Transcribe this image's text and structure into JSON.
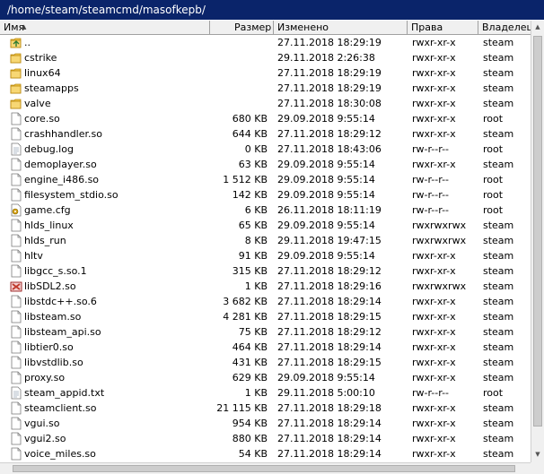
{
  "path": "/home/steam/steamcmd/masofkepb/",
  "columns": {
    "name": "Имя",
    "size": "Размер",
    "modified": "Изменено",
    "permissions": "Права",
    "owner": "Владелец"
  },
  "files": [
    {
      "name": "..",
      "size": "",
      "modified": "27.11.2018 18:29:19",
      "permissions": "rwxr-xr-x",
      "owner": "steam",
      "icon": "parent-folder-icon"
    },
    {
      "name": "cstrike",
      "size": "",
      "modified": "29.11.2018 2:26:38",
      "permissions": "rwxr-xr-x",
      "owner": "steam",
      "icon": "folder-icon"
    },
    {
      "name": "linux64",
      "size": "",
      "modified": "27.11.2018 18:29:19",
      "permissions": "rwxr-xr-x",
      "owner": "steam",
      "icon": "folder-icon"
    },
    {
      "name": "steamapps",
      "size": "",
      "modified": "27.11.2018 18:29:19",
      "permissions": "rwxr-xr-x",
      "owner": "steam",
      "icon": "folder-icon"
    },
    {
      "name": "valve",
      "size": "",
      "modified": "27.11.2018 18:30:08",
      "permissions": "rwxr-xr-x",
      "owner": "steam",
      "icon": "folder-icon"
    },
    {
      "name": "core.so",
      "size": "680 KB",
      "modified": "29.09.2018 9:55:14",
      "permissions": "rwxr-xr-x",
      "owner": "root",
      "icon": "file-icon"
    },
    {
      "name": "crashhandler.so",
      "size": "644 KB",
      "modified": "27.11.2018 18:29:12",
      "permissions": "rwxr-xr-x",
      "owner": "steam",
      "icon": "file-icon"
    },
    {
      "name": "debug.log",
      "size": "0 KB",
      "modified": "27.11.2018 18:43:06",
      "permissions": "rw-r--r--",
      "owner": "root",
      "icon": "text-file-icon"
    },
    {
      "name": "demoplayer.so",
      "size": "63 KB",
      "modified": "29.09.2018 9:55:14",
      "permissions": "rwxr-xr-x",
      "owner": "steam",
      "icon": "file-icon"
    },
    {
      "name": "engine_i486.so",
      "size": "1 512 KB",
      "modified": "29.09.2018 9:55:14",
      "permissions": "rw-r--r--",
      "owner": "root",
      "icon": "file-icon"
    },
    {
      "name": "filesystem_stdio.so",
      "size": "142 KB",
      "modified": "29.09.2018 9:55:14",
      "permissions": "rw-r--r--",
      "owner": "root",
      "icon": "file-icon"
    },
    {
      "name": "game.cfg",
      "size": "6 KB",
      "modified": "26.11.2018 18:11:19",
      "permissions": "rw-r--r--",
      "owner": "root",
      "icon": "config-file-icon"
    },
    {
      "name": "hlds_linux",
      "size": "65 KB",
      "modified": "29.09.2018 9:55:14",
      "permissions": "rwxrwxrwx",
      "owner": "steam",
      "icon": "file-icon"
    },
    {
      "name": "hlds_run",
      "size": "8 KB",
      "modified": "29.11.2018 19:47:15",
      "permissions": "rwxrwxrwx",
      "owner": "steam",
      "icon": "file-icon"
    },
    {
      "name": "hltv",
      "size": "91 KB",
      "modified": "29.09.2018 9:55:14",
      "permissions": "rwxr-xr-x",
      "owner": "steam",
      "icon": "file-icon"
    },
    {
      "name": "libgcc_s.so.1",
      "size": "315 KB",
      "modified": "27.11.2018 18:29:12",
      "permissions": "rwxr-xr-x",
      "owner": "steam",
      "icon": "file-icon"
    },
    {
      "name": "libSDL2.so",
      "size": "1 KB",
      "modified": "27.11.2018 18:29:16",
      "permissions": "rwxrwxrwx",
      "owner": "steam",
      "icon": "broken-link-icon"
    },
    {
      "name": "libstdc++.so.6",
      "size": "3 682 KB",
      "modified": "27.11.2018 18:29:14",
      "permissions": "rwxr-xr-x",
      "owner": "steam",
      "icon": "file-icon"
    },
    {
      "name": "libsteam.so",
      "size": "4 281 KB",
      "modified": "27.11.2018 18:29:15",
      "permissions": "rwxr-xr-x",
      "owner": "steam",
      "icon": "file-icon"
    },
    {
      "name": "libsteam_api.so",
      "size": "75 KB",
      "modified": "27.11.2018 18:29:12",
      "permissions": "rwxr-xr-x",
      "owner": "steam",
      "icon": "file-icon"
    },
    {
      "name": "libtier0.so",
      "size": "464 KB",
      "modified": "27.11.2018 18:29:14",
      "permissions": "rwxr-xr-x",
      "owner": "steam",
      "icon": "file-icon"
    },
    {
      "name": "libvstdlib.so",
      "size": "431 KB",
      "modified": "27.11.2018 18:29:15",
      "permissions": "rwxr-xr-x",
      "owner": "steam",
      "icon": "file-icon"
    },
    {
      "name": "proxy.so",
      "size": "629 KB",
      "modified": "29.09.2018 9:55:14",
      "permissions": "rwxr-xr-x",
      "owner": "steam",
      "icon": "file-icon"
    },
    {
      "name": "steam_appid.txt",
      "size": "1 KB",
      "modified": "29.11.2018 5:00:10",
      "permissions": "rw-r--r--",
      "owner": "root",
      "icon": "text-file-icon"
    },
    {
      "name": "steamclient.so",
      "size": "21 115 KB",
      "modified": "27.11.2018 18:29:18",
      "permissions": "rwxr-xr-x",
      "owner": "steam",
      "icon": "file-icon"
    },
    {
      "name": "vgui.so",
      "size": "954 KB",
      "modified": "27.11.2018 18:29:14",
      "permissions": "rwxr-xr-x",
      "owner": "steam",
      "icon": "file-icon"
    },
    {
      "name": "vgui2.so",
      "size": "880 KB",
      "modified": "27.11.2018 18:29:14",
      "permissions": "rwxr-xr-x",
      "owner": "steam",
      "icon": "file-icon"
    },
    {
      "name": "voice_miles.so",
      "size": "54 KB",
      "modified": "27.11.2018 18:29:14",
      "permissions": "rwxr-xr-x",
      "owner": "steam",
      "icon": "file-icon"
    }
  ],
  "colors": {
    "path_bar_bg": "#0a246a",
    "folder": "#f2c94c",
    "broken_link": "#c0392b"
  }
}
